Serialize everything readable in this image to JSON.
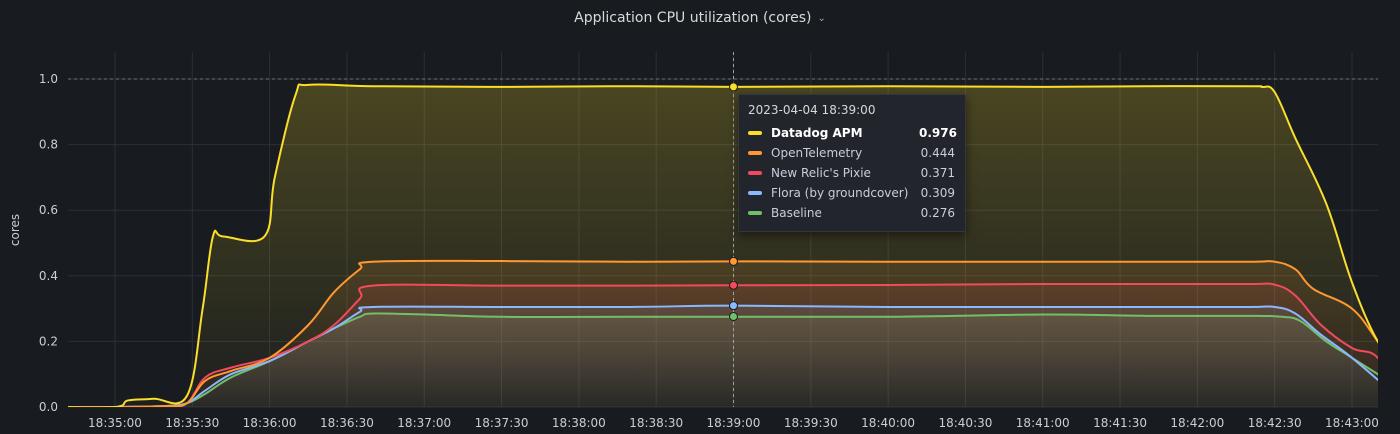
{
  "panel": {
    "title": "Application CPU utilization (cores)"
  },
  "chart_data": {
    "type": "area",
    "title": "Application CPU utilization (cores)",
    "ylabel": "cores",
    "xlabel": "",
    "ylim": [
      0,
      1.05
    ],
    "yticks": [
      "0.0",
      "0.2",
      "0.4",
      "0.6",
      "0.8",
      "1.0"
    ],
    "ytick_values": [
      0,
      0.2,
      0.4,
      0.6,
      0.8,
      1.0
    ],
    "xticks": [
      "18:35:00",
      "18:35:30",
      "18:36:00",
      "18:36:30",
      "18:37:00",
      "18:37:30",
      "18:38:00",
      "18:38:30",
      "18:39:00",
      "18:39:30",
      "18:40:00",
      "18:40:30",
      "18:41:00",
      "18:41:30",
      "18:42:00",
      "18:42:30",
      "18:43:00"
    ],
    "xlim_seconds_from_1835": [
      -25,
      500
    ],
    "threshold": 1.0,
    "grid": true,
    "series": [
      {
        "name": "Baseline",
        "color": "#73bf69",
        "points": [
          [
            -25,
            0
          ],
          [
            0,
            0
          ],
          [
            20,
            0.003
          ],
          [
            28,
            0.012
          ],
          [
            35,
            0.04
          ],
          [
            45,
            0.09
          ],
          [
            60,
            0.14
          ],
          [
            75,
            0.2
          ],
          [
            85,
            0.24
          ],
          [
            95,
            0.275
          ],
          [
            100,
            0.285
          ],
          [
            120,
            0.282
          ],
          [
            150,
            0.275
          ],
          [
            200,
            0.275
          ],
          [
            240,
            0.275
          ],
          [
            300,
            0.275
          ],
          [
            360,
            0.282
          ],
          [
            400,
            0.278
          ],
          [
            440,
            0.278
          ],
          [
            453,
            0.275
          ],
          [
            460,
            0.262
          ],
          [
            470,
            0.2
          ],
          [
            480,
            0.15
          ],
          [
            500,
            0.05
          ]
        ]
      },
      {
        "name": "Flora (by groundcover)",
        "color": "#8ab8ff",
        "points": [
          [
            -25,
            0
          ],
          [
            0,
            0
          ],
          [
            20,
            0.003
          ],
          [
            28,
            0.012
          ],
          [
            35,
            0.05
          ],
          [
            45,
            0.1
          ],
          [
            60,
            0.14
          ],
          [
            75,
            0.2
          ],
          [
            85,
            0.24
          ],
          [
            95,
            0.29
          ],
          [
            100,
            0.305
          ],
          [
            150,
            0.305
          ],
          [
            200,
            0.305
          ],
          [
            240,
            0.309
          ],
          [
            300,
            0.305
          ],
          [
            360,
            0.305
          ],
          [
            400,
            0.305
          ],
          [
            440,
            0.305
          ],
          [
            450,
            0.305
          ],
          [
            458,
            0.285
          ],
          [
            468,
            0.22
          ],
          [
            480,
            0.15
          ],
          [
            500,
            0.015
          ]
        ]
      },
      {
        "name": "New Relic's Pixie",
        "color": "#f2495c",
        "points": [
          [
            -25,
            0
          ],
          [
            0,
            0
          ],
          [
            20,
            0.003
          ],
          [
            28,
            0.012
          ],
          [
            35,
            0.09
          ],
          [
            45,
            0.12
          ],
          [
            60,
            0.15
          ],
          [
            75,
            0.2
          ],
          [
            85,
            0.25
          ],
          [
            95,
            0.33
          ],
          [
            100,
            0.37
          ],
          [
            150,
            0.37
          ],
          [
            200,
            0.37
          ],
          [
            240,
            0.371
          ],
          [
            300,
            0.372
          ],
          [
            360,
            0.375
          ],
          [
            400,
            0.375
          ],
          [
            440,
            0.375
          ],
          [
            450,
            0.373
          ],
          [
            458,
            0.34
          ],
          [
            468,
            0.25
          ],
          [
            480,
            0.18
          ],
          [
            490,
            0.15
          ],
          [
            500,
            0.015
          ]
        ]
      },
      {
        "name": "OpenTelemetry",
        "color": "#ff9830",
        "points": [
          [
            -25,
            0
          ],
          [
            0,
            0
          ],
          [
            20,
            0.003
          ],
          [
            28,
            0.012
          ],
          [
            35,
            0.08
          ],
          [
            45,
            0.11
          ],
          [
            60,
            0.15
          ],
          [
            75,
            0.25
          ],
          [
            85,
            0.35
          ],
          [
            95,
            0.42
          ],
          [
            100,
            0.443
          ],
          [
            150,
            0.445
          ],
          [
            200,
            0.443
          ],
          [
            240,
            0.444
          ],
          [
            300,
            0.443
          ],
          [
            360,
            0.443
          ],
          [
            400,
            0.443
          ],
          [
            440,
            0.443
          ],
          [
            450,
            0.443
          ],
          [
            458,
            0.42
          ],
          [
            465,
            0.36
          ],
          [
            480,
            0.3
          ],
          [
            490,
            0.2
          ],
          [
            500,
            0.09
          ]
        ]
      },
      {
        "name": "Datadog APM",
        "color": "#fade2a",
        "points": [
          [
            -25,
            0
          ],
          [
            0,
            0
          ],
          [
            5,
            0.02
          ],
          [
            15,
            0.025
          ],
          [
            28,
            0.035
          ],
          [
            34,
            0.3
          ],
          [
            38,
            0.52
          ],
          [
            42,
            0.52
          ],
          [
            58,
            0.52
          ],
          [
            62,
            0.7
          ],
          [
            70,
            0.95
          ],
          [
            75,
            0.982
          ],
          [
            100,
            0.978
          ],
          [
            150,
            0.976
          ],
          [
            200,
            0.978
          ],
          [
            240,
            0.976
          ],
          [
            300,
            0.978
          ],
          [
            360,
            0.976
          ],
          [
            400,
            0.978
          ],
          [
            440,
            0.978
          ],
          [
            445,
            0.976
          ],
          [
            450,
            0.96
          ],
          [
            458,
            0.82
          ],
          [
            470,
            0.62
          ],
          [
            480,
            0.38
          ],
          [
            490,
            0.2
          ],
          [
            500,
            0.1
          ]
        ]
      }
    ]
  },
  "hover": {
    "x_seconds": 240
  },
  "tooltip": {
    "time": "2023-04-04 18:39:00",
    "rows": [
      {
        "name": "Datadog APM",
        "value": "0.976",
        "color": "#fade2a",
        "active": true
      },
      {
        "name": "OpenTelemetry",
        "value": "0.444",
        "color": "#ff9830",
        "active": false
      },
      {
        "name": "New Relic's Pixie",
        "value": "0.371",
        "color": "#f2495c",
        "active": false
      },
      {
        "name": "Flora (by groundcover)",
        "value": "0.309",
        "color": "#8ab8ff",
        "active": false
      },
      {
        "name": "Baseline",
        "value": "0.276",
        "color": "#73bf69",
        "active": false
      }
    ]
  }
}
